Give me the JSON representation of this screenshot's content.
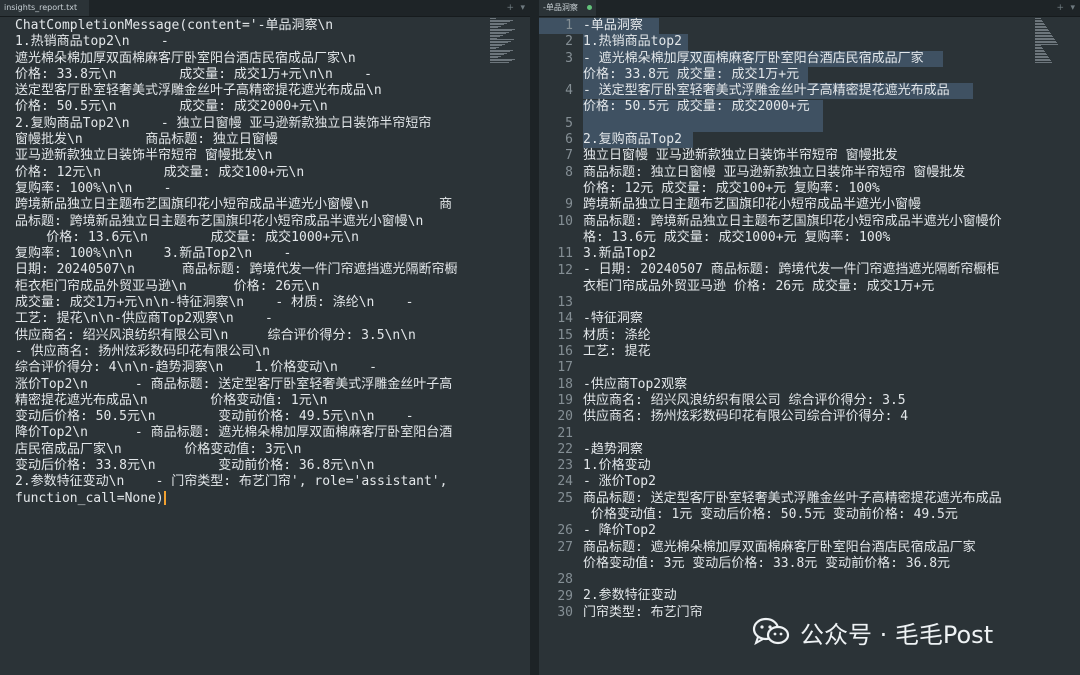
{
  "left_pane": {
    "tab_title": "insights_report.txt",
    "text_lines": [
      "ChatCompletionMessage(content='-单品洞察\\n",
      "1.热销商品top2\\n    -",
      "遮光棉朵棉加厚双面棉麻客厅卧室阳台酒店民宿成品厂家\\n",
      "价格: 33.8元\\n        成交量: 成交1万+元\\n\\n    -",
      "送定型客厅卧室轻奢美式浮雕金丝叶子高精密提花遮光布成品\\n",
      "价格: 50.5元\\n        成交量: 成交2000+元\\n",
      "2.复购商品Top2\\n    - 独立日窗幔 亚马逊新款独立日装饰半帘短帘",
      "窗幔批发\\n        商品标题: 独立日窗幔",
      "亚马逊新款独立日装饰半帘短帘 窗幔批发\\n",
      "价格: 12元\\n        成交量: 成交100+元\\n",
      "复购率: 100%\\n\\n    -",
      "跨境新品独立日主题布艺国旗印花小短帘成品半遮光小窗幔\\n         商",
      "品标题: 跨境新品独立日主题布艺国旗印花小短帘成品半遮光小窗幔\\n",
      "    价格: 13.6元\\n        成交量: 成交1000+元\\n",
      "复购率: 100%\\n\\n    3.新品Top2\\n    -",
      "日期: 20240507\\n      商品标题: 跨境代发一件门帘遮挡遮光隔断帘橱",
      "柜衣柜门帘成品外贸亚马逊\\n      价格: 26元\\n",
      "成交量: 成交1万+元\\n\\n-特征洞察\\n    - 材质: 涤纶\\n    -",
      "工艺: 提花\\n\\n-供应商Top2观察\\n    -",
      "供应商名: 绍兴风浪纺织有限公司\\n     综合评价得分: 3.5\\n\\n",
      "- 供应商名: 扬州炫彩数码印花有限公司\\n",
      "综合评价得分: 4\\n\\n-趋势洞察\\n    1.价格变动\\n    -",
      "涨价Top2\\n      - 商品标题: 送定型客厅卧室轻奢美式浮雕金丝叶子高",
      "精密提花遮光布成品\\n        价格变动值: 1元\\n",
      "变动后价格: 50.5元\\n        变动前价格: 49.5元\\n\\n    -",
      "降价Top2\\n      - 商品标题: 遮光棉朵棉加厚双面棉麻客厅卧室阳台酒",
      "店民宿成品厂家\\n        价格变动值: 3元\\n",
      "变动后价格: 33.8元\\n        变动前价格: 36.8元\\n\\n",
      "2.参数特征变动\\n    - 门帘类型: 布艺门帘', role='assistant',",
      "function_call=None)"
    ]
  },
  "right_pane": {
    "tab_title": "-单品洞察",
    "lines": [
      {
        "num": "1",
        "text": "-单品洞察"
      },
      {
        "num": "2",
        "text": "1.热销商品top2"
      },
      {
        "num": "3",
        "text": "- 遮光棉朵棉加厚双面棉麻客厅卧室阳台酒店民宿成品厂家"
      },
      {
        "num": "",
        "text": "价格: 33.8元 成交量: 成交1万+元"
      },
      {
        "num": "4",
        "text": "- 送定型客厅卧室轻奢美式浮雕金丝叶子高精密提花遮光布成品"
      },
      {
        "num": "",
        "text": "价格: 50.5元 成交量: 成交2000+元"
      },
      {
        "num": "5",
        "text": ""
      },
      {
        "num": "6",
        "text": "2.复购商品Top2"
      },
      {
        "num": "7",
        "text": "独立日窗幔 亚马逊新款独立日装饰半帘短帘 窗幔批发"
      },
      {
        "num": "8",
        "text": "商品标题: 独立日窗幔 亚马逊新款独立日装饰半帘短帘 窗幔批发"
      },
      {
        "num": "",
        "text": "价格: 12元 成交量: 成交100+元 复购率: 100%"
      },
      {
        "num": "9",
        "text": "跨境新品独立日主题布艺国旗印花小短帘成品半遮光小窗幔"
      },
      {
        "num": "10",
        "text": "商品标题: 跨境新品独立日主题布艺国旗印花小短帘成品半遮光小窗幔价"
      },
      {
        "num": "",
        "text": "格: 13.6元 成交量: 成交1000+元 复购率: 100%"
      },
      {
        "num": "11",
        "text": "3.新品Top2"
      },
      {
        "num": "12",
        "text": "- 日期: 20240507 商品标题: 跨境代发一件门帘遮挡遮光隔断帘橱柜"
      },
      {
        "num": "",
        "text": "衣柜门帘成品外贸亚马逊 价格: 26元 成交量: 成交1万+元"
      },
      {
        "num": "13",
        "text": ""
      },
      {
        "num": "14",
        "text": "-特征洞察"
      },
      {
        "num": "15",
        "text": "材质: 涤纶"
      },
      {
        "num": "16",
        "text": "工艺: 提花"
      },
      {
        "num": "17",
        "text": ""
      },
      {
        "num": "18",
        "text": "-供应商Top2观察"
      },
      {
        "num": "19",
        "text": "供应商名: 绍兴风浪纺织有限公司 综合评价得分: 3.5"
      },
      {
        "num": "20",
        "text": "供应商名: 扬州炫彩数码印花有限公司综合评价得分: 4"
      },
      {
        "num": "21",
        "text": ""
      },
      {
        "num": "22",
        "text": "-趋势洞察"
      },
      {
        "num": "23",
        "text": "1.价格变动"
      },
      {
        "num": "24",
        "text": "- 涨价Top2"
      },
      {
        "num": "25",
        "text": "商品标题: 送定型客厅卧室轻奢美式浮雕金丝叶子高精密提花遮光布成品"
      },
      {
        "num": "",
        "text": " 价格变动值: 1元 变动后价格: 50.5元 变动前价格: 49.5元"
      },
      {
        "num": "26",
        "text": "- 降价Top2"
      },
      {
        "num": "27",
        "text": "商品标题: 遮光棉朵棉加厚双面棉麻客厅卧室阳台酒店民宿成品厂家"
      },
      {
        "num": "",
        "text": "价格变动值: 3元 变动后价格: 33.8元 变动前价格: 36.8元"
      },
      {
        "num": "28",
        "text": ""
      },
      {
        "num": "29",
        "text": "2.参数特征变动"
      },
      {
        "num": "30",
        "text": "门帘类型: 布艺门帘"
      }
    ]
  },
  "watermark": {
    "text": "公众号 · 毛毛Post"
  },
  "colors": {
    "editor_bg": "#2b3337",
    "text": "#e3e7ea",
    "line_number": "#858f95",
    "selection": "#3f5162",
    "caret": "#f0a030",
    "saved_dot": "#62c27a"
  }
}
